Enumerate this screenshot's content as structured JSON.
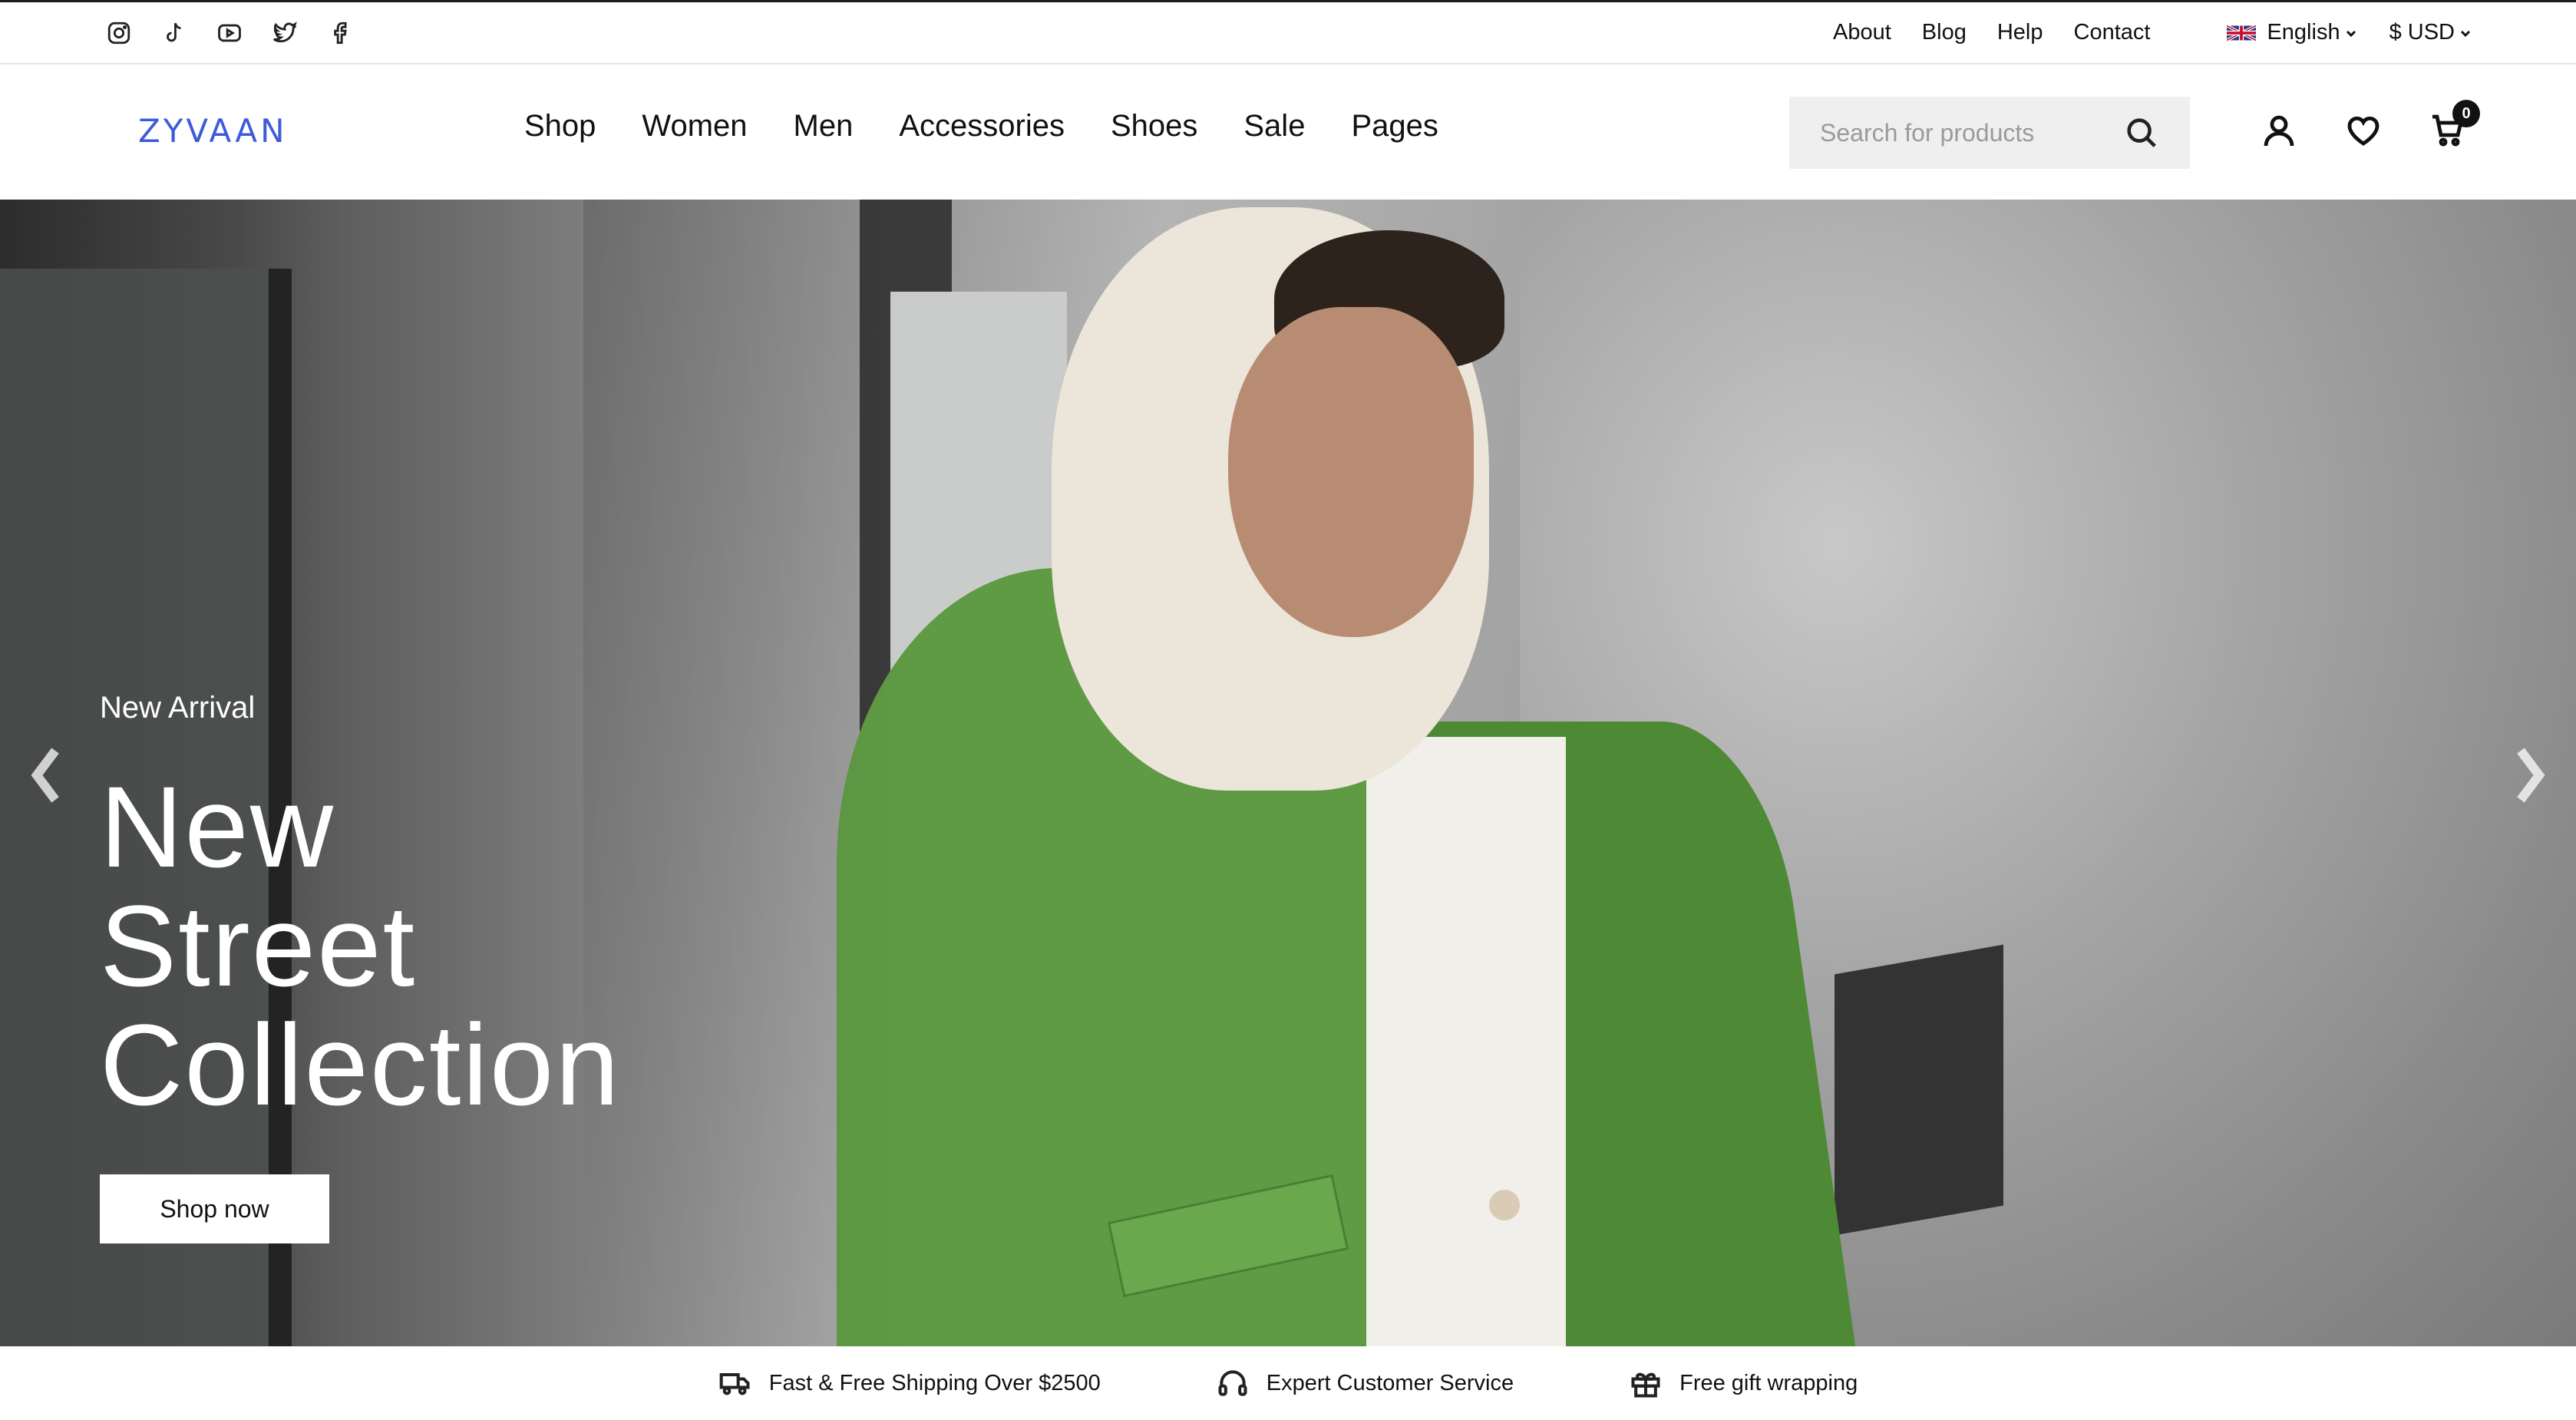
{
  "topbar": {
    "social": [
      {
        "icon": "instagram-icon"
      },
      {
        "icon": "tiktok-icon"
      },
      {
        "icon": "youtube-icon"
      },
      {
        "icon": "twitter-icon"
      },
      {
        "icon": "facebook-icon"
      }
    ],
    "links": [
      "About",
      "Blog",
      "Help",
      "Contact"
    ],
    "language": "English",
    "currency": "$ USD"
  },
  "header": {
    "logo": "ZYVAAN",
    "nav": [
      "Shop",
      "Women",
      "Men",
      "Accessories",
      "Shoes",
      "Sale",
      "Pages"
    ],
    "search_placeholder": "Search for products",
    "cart_count": "0"
  },
  "hero": {
    "eyebrow": "New Arrival",
    "title_line1": "New",
    "title_line2": "Street",
    "title_line3": "Collection",
    "button": "Shop now"
  },
  "features": [
    {
      "icon": "truck-icon",
      "label": "Fast & Free Shipping Over $2500"
    },
    {
      "icon": "headphones-icon",
      "label": "Expert Customer Service"
    },
    {
      "icon": "gift-icon",
      "label": "Free gift wrapping"
    }
  ],
  "colors": {
    "logo": "#3d5bd9",
    "jacket": "#5f9a44",
    "search_bg": "#efefef"
  }
}
